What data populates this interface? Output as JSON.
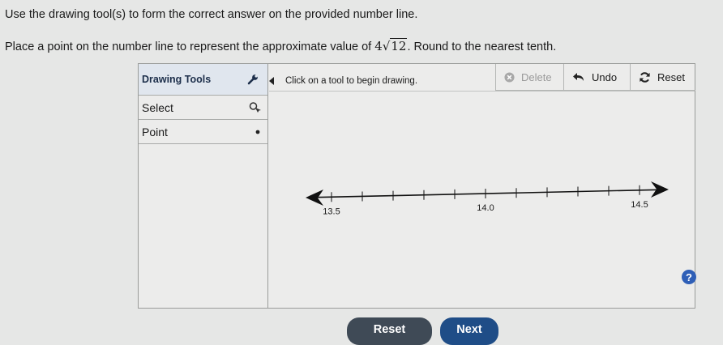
{
  "instructions": {
    "line1": "Use the drawing tool(s) to form the correct answer on the provided number line.",
    "line2_before": "Place a point on the number line to represent the approximate value of ",
    "coefficient": "4",
    "radical_sign": "√",
    "radicand": "12",
    "line2_after": ". Round to the nearest tenth."
  },
  "tool_panel": {
    "title": "Drawing Tools",
    "tools": [
      {
        "label": "Select",
        "icon": "pointer-icon"
      },
      {
        "label": "Point",
        "icon": "point-icon"
      }
    ]
  },
  "toolbar": {
    "hint": "Click on a tool to begin drawing.",
    "delete_label": "Delete",
    "undo_label": "Undo",
    "reset_label": "Reset"
  },
  "number_line": {
    "labels": [
      "13.5",
      "14.0",
      "14.5"
    ],
    "min_label_value": 13.5,
    "max_label_value": 14.5,
    "tick_step": 0.1
  },
  "help": {
    "label": "?"
  },
  "footer": {
    "reset_label": "Reset",
    "next_label": "Next"
  },
  "colors": {
    "accent": "#2f5fb7",
    "next_button": "#1f4d87",
    "reset_button": "#3f4a56"
  }
}
